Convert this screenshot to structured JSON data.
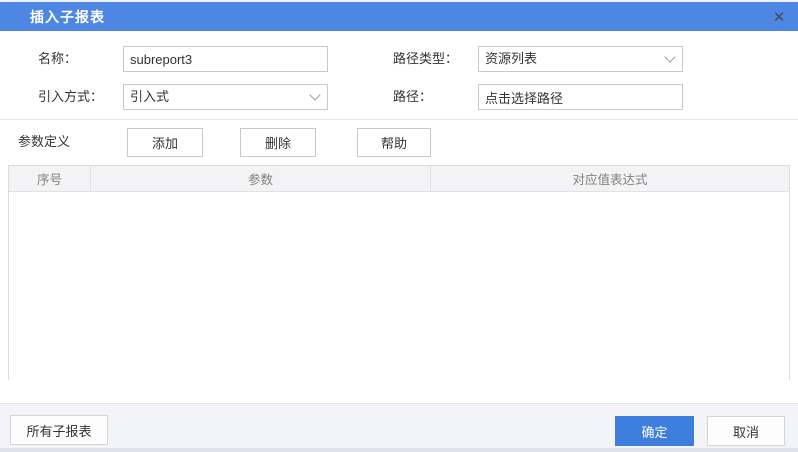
{
  "dialog": {
    "title": "插入子报表",
    "close_icon": "✕"
  },
  "form": {
    "name_label": "名称：",
    "name_value": "subreport3",
    "path_type_label": "路径类型：",
    "path_type_value": "资源列表",
    "import_mode_label": "引入方式：",
    "import_mode_value": "引入式",
    "path_label": "路径：",
    "path_value": "点击选择路径"
  },
  "params": {
    "section_label": "参数定义",
    "add_label": "添加",
    "delete_label": "删除",
    "help_label": "帮助",
    "table": {
      "headers": [
        "序号",
        "参数",
        "对应值表达式"
      ],
      "rows": []
    }
  },
  "footer": {
    "all_subreports_label": "所有子报表",
    "ok_label": "确定",
    "cancel_label": "取消"
  },
  "colors": {
    "title_bar": "#4d87e3",
    "ok_button": "#3d7edd"
  }
}
